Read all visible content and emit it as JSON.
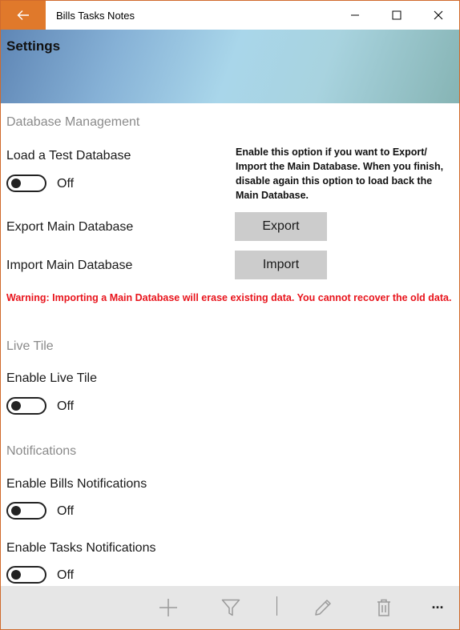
{
  "window": {
    "title": "Bills Tasks Notes",
    "controls": [
      "minimize-icon",
      "maximize-icon",
      "close-icon"
    ]
  },
  "header": {
    "title": "Settings"
  },
  "database": {
    "section_title": "Database Management",
    "test_db_label": "Load a Test Database",
    "test_db_state": "Off",
    "info": "Enable this option if you want to Export/ Import the Main Database. When you finish, disable again this option to load back the Main Database.",
    "export_label": "Export Main Database",
    "export_button": "Export",
    "import_label": "Import Main Database",
    "import_button": "Import",
    "warning": "Warning: Importing a Main Database will erase existing data. You cannot recover the old data."
  },
  "live_tile": {
    "section_title": "Live Tile",
    "enable_label": "Enable Live Tile",
    "enable_state": "Off"
  },
  "notifications": {
    "section_title": "Notifications",
    "bills_label": "Enable Bills Notifications",
    "bills_state": "Off",
    "tasks_label": "Enable Tasks Notifications",
    "tasks_state": "Off"
  },
  "appbar": {
    "icons": [
      "add-icon",
      "filter-icon",
      "edit-icon",
      "delete-icon",
      "more-icon"
    ],
    "more_glyph": "···"
  },
  "colors": {
    "accent": "#e0792b",
    "warning": "#e8141c",
    "section_title": "#8a8a8a",
    "button_bg": "#cccccc",
    "appbar_bg": "#e6e6e6"
  }
}
